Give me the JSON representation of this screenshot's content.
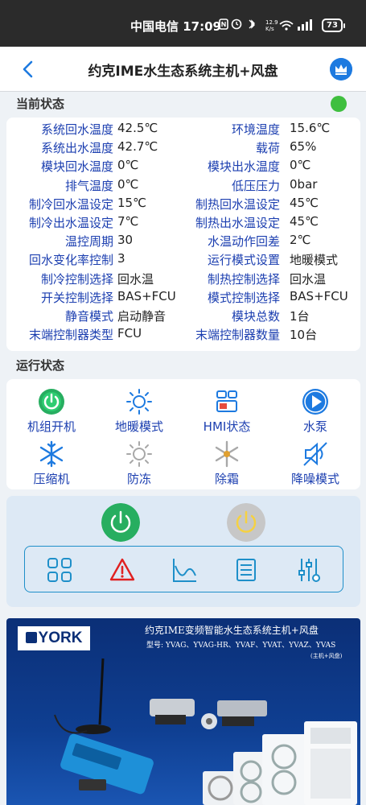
{
  "statusbar": {
    "carrier": "中国电信 17:09",
    "speed_top": "12.9",
    "speed_bottom": "K/s",
    "battery": "73"
  },
  "header": {
    "title": "约克IME水生态系统主机+风盘"
  },
  "current_status": {
    "label": "当前状态",
    "indicator_color": "#3fbf3f",
    "rows": [
      {
        "l1": "系统回水温度",
        "v1": "42.5℃",
        "l2": "环境温度",
        "v2": "15.6℃"
      },
      {
        "l1": "系统出水温度",
        "v1": "42.7℃",
        "l2": "载荷",
        "v2": "65%"
      },
      {
        "l1": "模块回水温度",
        "v1": "0℃",
        "l2": "模块出水温度",
        "v2": "0℃"
      },
      {
        "l1": "排气温度",
        "v1": "0℃",
        "l2": "低压压力",
        "v2": "0bar"
      },
      {
        "l1": "制冷回水温设定",
        "v1": "15℃",
        "l2": "制热回水温设定",
        "v2": "45℃"
      },
      {
        "l1": "制冷出水温设定",
        "v1": "7℃",
        "l2": "制热出水温设定",
        "v2": "45℃"
      },
      {
        "l1": "温控周期",
        "v1": "30",
        "l2": "水温动作回差",
        "v2": "2℃"
      },
      {
        "l1": "回水变化率控制",
        "v1": "3",
        "l2": "运行模式设置",
        "v2": "地暖模式"
      },
      {
        "l1": "制冷控制选择",
        "v1": "回水温",
        "l2": "制热控制选择",
        "v2": "回水温"
      },
      {
        "l1": "开关控制选择",
        "v1": "BAS+FCU",
        "l2": "模式控制选择",
        "v2": "BAS+FCU"
      },
      {
        "l1": "静音模式",
        "v1": "启动静音",
        "l2": "模块总数",
        "v2": "1台"
      },
      {
        "l1": "末端控制器类型",
        "v1": "FCU",
        "l2": "末端控制器数量",
        "v2": "10台"
      }
    ]
  },
  "run_status": {
    "label": "运行状态",
    "items": [
      {
        "label": "机组开机",
        "icon": "power-on-icon",
        "active": true
      },
      {
        "label": "地暖模式",
        "icon": "sun-icon",
        "active": true
      },
      {
        "label": "HMI状态",
        "icon": "hmi-icon",
        "active": true
      },
      {
        "label": "水泵",
        "icon": "pump-play-icon",
        "active": true
      },
      {
        "label": "压缩机",
        "icon": "snowflake-icon",
        "active": true
      },
      {
        "label": "防冻",
        "icon": "sun-grey-icon",
        "active": false
      },
      {
        "label": "除霜",
        "icon": "snowflake-grey-icon",
        "active": false
      },
      {
        "label": "降噪模式",
        "icon": "mute-icon",
        "active": true
      }
    ]
  },
  "controls": {
    "power_on_color": "#27ae60",
    "power_off_color": "#c7c7c7",
    "tools": [
      "grid-icon",
      "alarm-icon",
      "curve-icon",
      "list-icon",
      "settings-sliders-icon"
    ]
  },
  "banner": {
    "logo": "YORK",
    "title": "约克IME变频智能水生态系统主机+风盘",
    "models": "型号: YVAG、YVAG-HR、YVAF、YVAT、YVAZ、YVAS",
    "sub": "(主机+风盘)"
  }
}
